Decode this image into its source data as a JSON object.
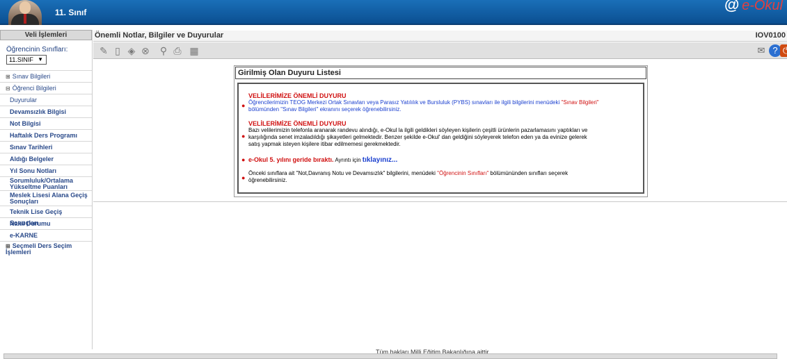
{
  "header": {
    "class_title": "11. Sınıf",
    "logo_text": "e-Okul"
  },
  "sidebar": {
    "title": "Veli İşlemleri",
    "class_label": "Öğrencinin Sınıfları:",
    "class_select_value": "11.SINIF",
    "items": [
      {
        "label": "Sınav Bilgileri",
        "kind": "section-collapsed"
      },
      {
        "label": "Öğrenci Bilgileri",
        "kind": "section-expanded"
      },
      {
        "label": "Duyurular",
        "kind": "sub"
      },
      {
        "label": "Devamsızlık Bilgisi",
        "kind": "sub"
      },
      {
        "label": "Not Bilgisi",
        "kind": "sub"
      },
      {
        "label": "Haftalık Ders Programı",
        "kind": "sub"
      },
      {
        "label": "Sınav Tarihleri",
        "kind": "sub"
      },
      {
        "label": "Aldığı Belgeler",
        "kind": "sub"
      },
      {
        "label": "Yıl Sonu Notları",
        "kind": "sub"
      },
      {
        "label": "Sorumluluk/Ortalama Yükseltme Puanları",
        "kind": "sub"
      },
      {
        "label": "Meslek Lisesi Alana Geçiş Sonuçları",
        "kind": "sub"
      },
      {
        "label": "Teknik Lise Geçiş Sonuçları",
        "kind": "sub"
      },
      {
        "label": "Nakil Durumu",
        "kind": "sub"
      },
      {
        "label": "e-KARNE",
        "kind": "sub"
      },
      {
        "label": "Seçmeli Ders Seçim İşlemleri",
        "kind": "section-collapsed"
      }
    ]
  },
  "page": {
    "title": "Önemli Notlar, Bilgiler ve Duyurular",
    "code": "IOV0100"
  },
  "panel": {
    "title": "Girilmiş Olan Duyuru Listesi",
    "announcements": {
      "a1_heading": "VELİLERİMİZE ÖNEMLİ DUYURU",
      "a1_text1": "Öğrencilerimizin TEOG Merkezi Ortak Sınavları veya Parasız Yatılılık ve Bursluluk (PYBS) sınavları ile ilgili bilgilerini menüdeki ",
      "a1_link": "\"Sınav Bilgileri\"",
      "a1_text2": "bölümünden \"Sınav Bilgileri\" ekranını seçerek öğrenebilirsiniz.",
      "a2_heading": "VELİLERİMİZE ÖNEMLİ DUYURU",
      "a2_line1": "Bazı velilerimizin telefonla aranarak randevu alındığı, e-Okul la ilgili geldikleri söyleyen kişilerin çeşitli ürünlerin pazarlamasını yaptıkları ve",
      "a2_line2": "karşılığında senet imzaladıldığı şikayetleri gelmektedir. Benzer şekilde e-Okul' dan geldiğini söyleyerek telefon eden ya da evinize gelerek",
      "a2_line3": "satış yapmak isteyen kişilere itibar edilmemesi gerekmektedir.",
      "a3_bold": "e-Okul 5. yılını geride bıraktı.",
      "a3_text": " Ayrıntı için ",
      "a3_link": "tıklayınız...",
      "a4_text1": "Önceki sınıflara ait \"Not,Davranış Notu ve Devamsızlık\" bilgilerini, menüdeki ",
      "a4_link": "\"Öğrencinin Sınıfları\"",
      "a4_text2": " bölümününden sınıfları seçerek",
      "a4_text3": "öğrenebilirsiniz."
    }
  },
  "footer": {
    "text": "Tüm hakları Milli Eğitim Bakanlığına aittir"
  },
  "colors": {
    "header_blue": "#0b4f91",
    "alert_red": "#d01010",
    "text_blue": "#1a3fcf"
  },
  "icons": [
    "edit-icon",
    "delete-icon",
    "tool-icon",
    "cancel-icon",
    "search-icon",
    "print-icon",
    "export-icon",
    "mail-icon",
    "help-icon",
    "exit-icon"
  ]
}
